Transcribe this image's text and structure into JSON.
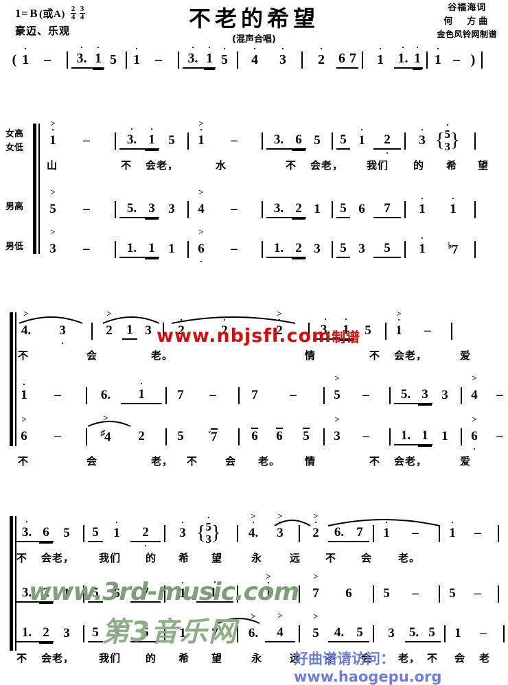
{
  "header": {
    "key_label": "1=",
    "key_value": "B",
    "key_alt": "(或A)",
    "meters": [
      {
        "num": "2",
        "den": "4"
      },
      {
        "num": "3",
        "den": "4"
      }
    ],
    "tempo_mark": "豪迈、乐观",
    "title": "不老的希望",
    "subtitle": "(混声合唱)",
    "credit_lyricist": "谷福海词",
    "credit_composer": "何　方曲",
    "credit_engraver": "金色风铃网制谱"
  },
  "intro": {
    "label": "intro-line",
    "tokens": "( 1̇ - | 3̇. 1̇ 5 | 1̇ - | 3̇. 1̇ 5̇ | 4̇ 3̇ | 2̇ 6 7 | 1̇ 1̇. 1̇ | 1̇ - ) |",
    "notes": [
      {
        "g": "(",
        "t": "paren"
      },
      {
        "g": "1",
        "oct": "up",
        "t": "note"
      },
      {
        "g": "-",
        "t": "dash"
      },
      {
        "g": "|",
        "t": "bar"
      },
      {
        "g": "3.",
        "oct": "up",
        "t": "note",
        "beam": 1
      },
      {
        "g": "1",
        "oct": "up",
        "t": "note",
        "beam": 2
      },
      {
        "g": "5",
        "t": "note"
      },
      {
        "g": "|",
        "t": "bar"
      },
      {
        "g": "1",
        "oct": "up",
        "t": "note"
      },
      {
        "g": "-",
        "t": "dash"
      },
      {
        "g": "|",
        "t": "bar"
      },
      {
        "g": "3.",
        "oct": "up",
        "t": "note",
        "beam": 1
      },
      {
        "g": "1",
        "oct": "up",
        "t": "note",
        "beam": 2
      },
      {
        "g": "5",
        "oct": "up",
        "t": "note"
      },
      {
        "g": "|",
        "t": "bar"
      },
      {
        "g": "4",
        "oct": "up",
        "t": "note"
      },
      {
        "g": "3",
        "oct": "up",
        "t": "note"
      },
      {
        "g": "|",
        "t": "bar"
      },
      {
        "g": "2",
        "oct": "up",
        "t": "note"
      },
      {
        "g": "6",
        "t": "note",
        "beam": 1
      },
      {
        "g": "7",
        "t": "note",
        "beam": 1
      },
      {
        "g": "|",
        "t": "bar"
      },
      {
        "g": "1",
        "oct": "up",
        "t": "note"
      },
      {
        "g": "1.",
        "oct": "up",
        "t": "note",
        "beam": 1
      },
      {
        "g": "1",
        "oct": "up",
        "t": "note",
        "beam": 2
      },
      {
        "g": "|",
        "t": "bar"
      },
      {
        "g": "1",
        "oct": "up",
        "t": "note"
      },
      {
        "g": "-",
        "t": "dash"
      },
      {
        "g": ")",
        "t": "paren"
      },
      {
        "g": "|",
        "t": "bar"
      }
    ]
  },
  "voices": {
    "soprano_alto": "女高\n女低",
    "soprano": "女高",
    "alto": "女低",
    "tenor": "男高",
    "bass": "男低"
  },
  "systems": [
    {
      "name": "system-1",
      "upper_staff": {
        "voice": [
          "女高",
          "女低"
        ],
        "notes": "1̇ - | 3̇. 1̇ 5 | 1̇ - | 3̇. 6 5 | 5 1̇ 2̇ | 3̇ {5̇/3̇} |",
        "lyrics": [
          "山",
          "不",
          "会老，",
          "水",
          "不",
          "会老，",
          "我们",
          "的",
          "希",
          "望"
        ]
      },
      "tenor_staff": {
        "voice": "男高",
        "notes": "5 - | 5. 3 3 | 4 - | 3. 2 1 | 5 6 7 | 1̇ 1̇ |"
      },
      "bass_staff": {
        "voice": "男低",
        "notes": "3 - | 1. 1 1 | 6̩ - | 1. 2 3 | 5 3 5 | 1̇ ♭7 |"
      }
    },
    {
      "name": "system-2",
      "upper_staff": {
        "notes": "4. 3 | 2 1 3 | 2̇ 2̇ 2̇ | 3̇. 1̇ 5 | 1̇ - |",
        "lyrics": [
          "不",
          "会",
          "老。",
          "情",
          "不",
          "会老，",
          "爱"
        ]
      },
      "tenor_staff": {
        "notes": "1̇ - | 6. 1̇ | 7 - | 7 - | 5 - | 5. 3 3 | 4 - |"
      },
      "bass_staff": {
        "notes": "6 - | ♯4 2 | 5 ᵛ7̄ | 6̄ 6̄ 5̄ | 3 - | 1. 1 1 | 6̩ - |",
        "lyrics": [
          "不",
          "会",
          "老，",
          "不",
          "会",
          "老。",
          "情",
          "不",
          "会老，",
          "爱"
        ]
      }
    },
    {
      "name": "system-3",
      "upper_staff": {
        "notes": "3̇. 6 5 | 5 1̇ 2̇ | 3̇ {5̇/3̇} | 4̇. 3̇ | 2̇ 6. 7 | 1̇ - | 1̇ - |",
        "lyrics": [
          "不",
          "会老，",
          "我们",
          "的",
          "希",
          "望",
          "永",
          "远",
          "不",
          "会",
          "老。"
        ]
      },
      "tenor_staff": {
        "notes": "3. 2 1 | 5 6 7 | 1̇ 1̇. | 1̇ | 7 6 | 5 - | 5 - |"
      },
      "bass_staff": {
        "notes": "1. 2 3 | 5 3 5 | 1̇ 7 | 6. 4 | 5 4. 5 | 3 5. 5 | 1 - |",
        "lyrics": [
          "不",
          "会老，",
          "我们",
          "的",
          "希",
          "望",
          "永",
          "远",
          "不",
          "会",
          "老，",
          "不",
          "会",
          "老"
        ]
      }
    }
  ],
  "watermarks": {
    "red": "www.nbjsfl.com",
    "red_suffix": "制谱",
    "green_url": "www.3rd-music.com",
    "green_name": "第3音乐网",
    "blue": "好曲谱请访问：www.haogepu.org"
  },
  "colors": {
    "ink": "#000000",
    "watermark_red": "#cc1111",
    "watermark_green": "#8fae88",
    "watermark_blue": "#6f7fd6",
    "paper": "#ffffff"
  },
  "chart_data": {
    "type": "table",
    "title": "不老的希望 — 混声合唱简谱",
    "xlabel": "",
    "ylabel": "",
    "categories": [
      "女高/女低",
      "男高",
      "男低"
    ],
    "series": [
      {
        "name": "女高/女低",
        "values": [
          "1̇ -",
          "3̇. 1̇ 5",
          "1̇ -",
          "3̇. 6 5",
          "5 1̇ 2̇",
          "3̇ {5̇/3̇}",
          "4. 3",
          "2 1 3",
          "2̇ 2̇ 2̇",
          "3̇. 1̇ 5",
          "1̇ -",
          "3̇. 6 5",
          "5 1̇ 2̇",
          "3̇ {5̇/3̇}",
          "4̇. 3̇",
          "2̇ 6. 7",
          "1̇ -",
          "1̇ -"
        ]
      },
      {
        "name": "男高",
        "values": [
          "5 -",
          "5. 3 3",
          "4 -",
          "3. 2 1",
          "5 6 7",
          "1̇ 1̇",
          "1̇ -",
          "6. 1̇",
          "7 -",
          "7 -",
          "5 -",
          "5. 3 3",
          "4 -",
          "3. 2 1",
          "5 6 7",
          "1̇ 1̇.",
          "1̇ 7 6",
          "5 -",
          "5 -"
        ]
      },
      {
        "name": "男低",
        "values": [
          "3 -",
          "1. 1 1",
          "6̩ -",
          "1. 2 3",
          "5 3 5",
          "1̇ ♭7",
          "6 -",
          "♯4 2",
          "5 ᵛ7̄",
          "6̄ 6̄ 5̄",
          "3 -",
          "1. 1 1",
          "6̩ -",
          "1. 2 3",
          "5 3 5",
          "1̇ 7",
          "6. 4",
          "5 4. 5",
          "3 5. 5",
          "1 -"
        ]
      }
    ]
  }
}
